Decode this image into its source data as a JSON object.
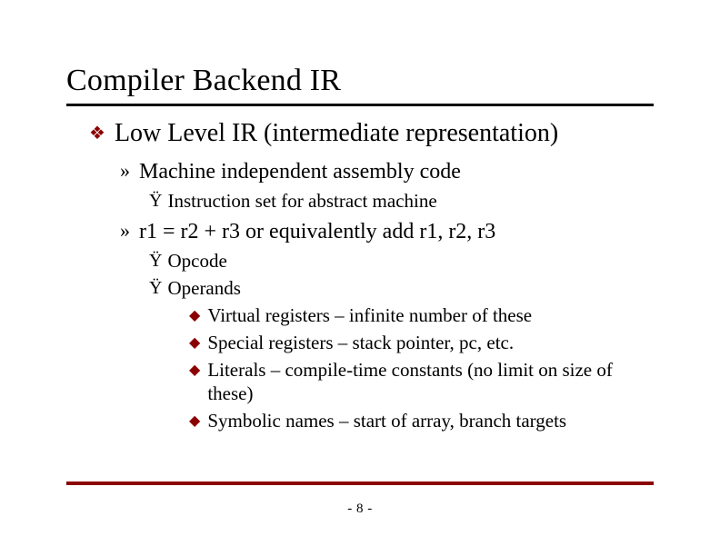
{
  "title": "Compiler Backend IR",
  "bullets": {
    "lvl1": {
      "glyph": "❖",
      "text": "Low Level IR (intermediate representation)"
    },
    "lvl2a": {
      "glyph": "»",
      "text": "Machine independent assembly code"
    },
    "lvl3a": {
      "glyph": "Ÿ",
      "text": "Instruction set for abstract machine"
    },
    "lvl2b": {
      "glyph": "»",
      "text": "r1 = r2 + r3 or equivalently add r1, r2, r3"
    },
    "lvl3b": {
      "glyph": "Ÿ",
      "text": "Opcode"
    },
    "lvl3c": {
      "glyph": "Ÿ",
      "text": "Operands"
    },
    "lvl4a": {
      "glyph": "◆",
      "text": "Virtual registers – infinite number of these"
    },
    "lvl4b": {
      "glyph": "◆",
      "text": "Special registers – stack pointer, pc, etc."
    },
    "lvl4c": {
      "glyph": "◆",
      "text": "Literals – compile-time constants (no limit on size of these)"
    },
    "lvl4d": {
      "glyph": "◆",
      "text": "Symbolic names – start of array, branch targets"
    }
  },
  "page_number": "- 8 -"
}
